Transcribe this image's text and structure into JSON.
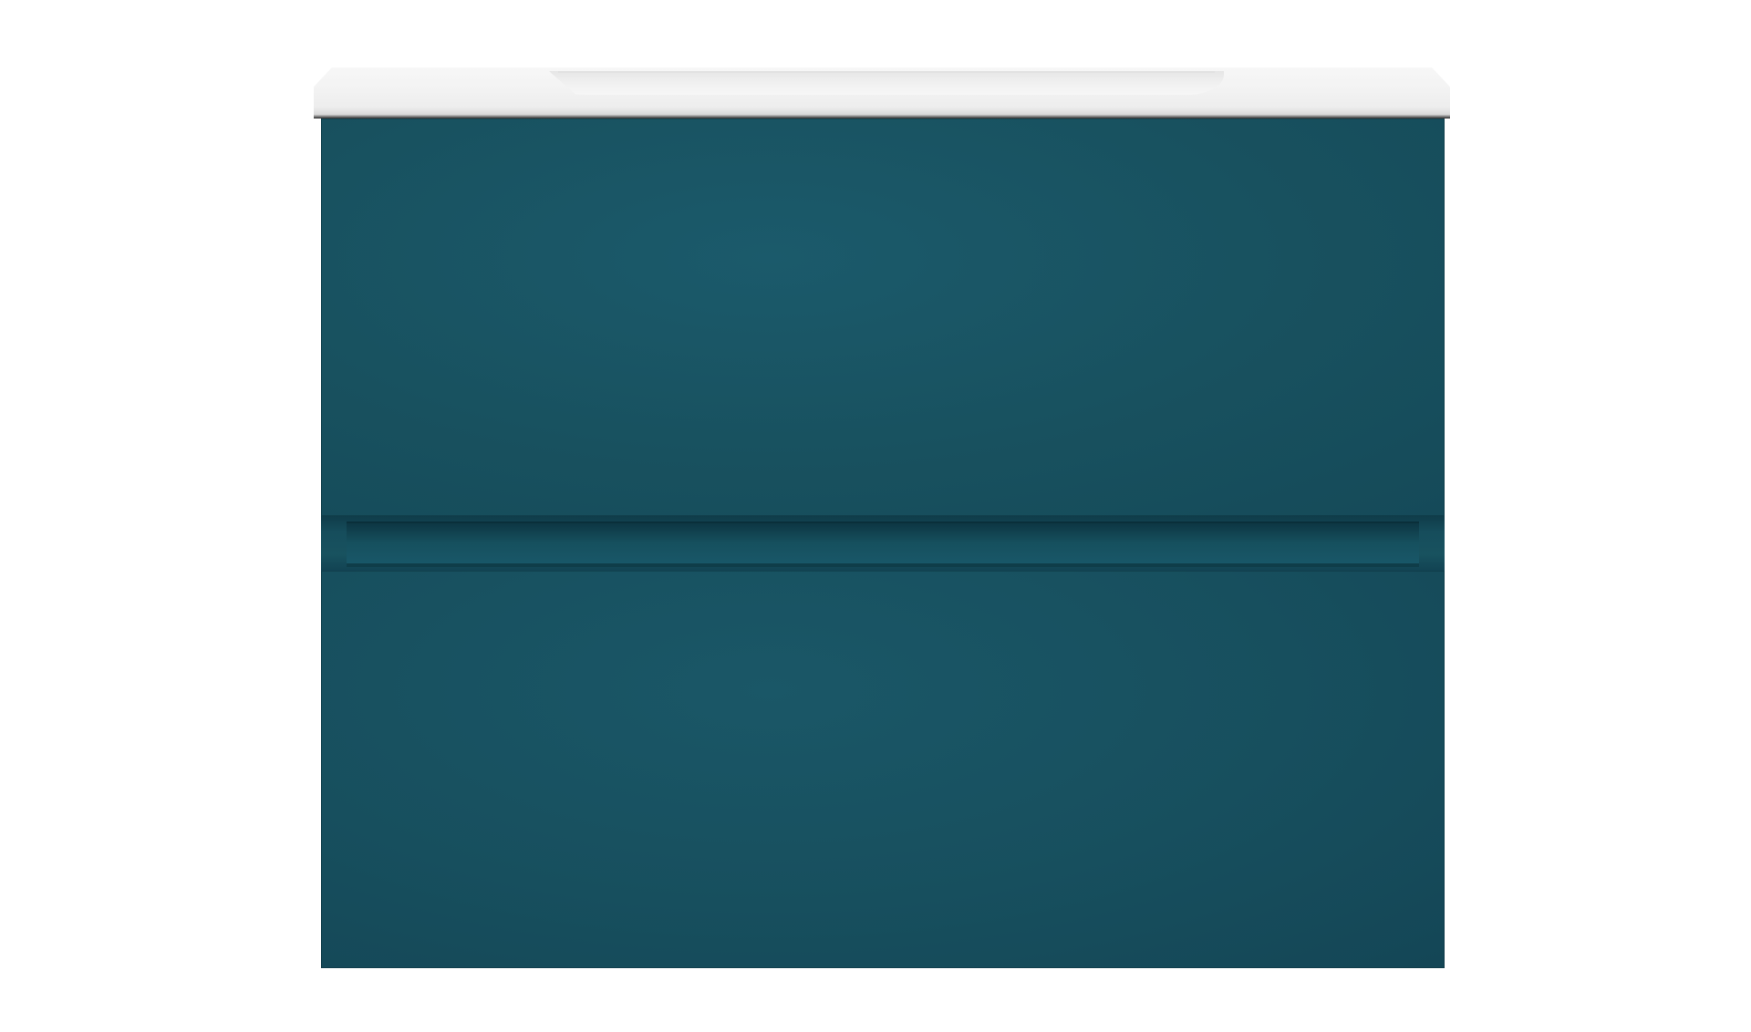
{
  "image": {
    "subject": "",
    "colors": {
      "background": "#ffffff",
      "cabinet": "#174b5a",
      "countertop": "#f3f3f3"
    }
  }
}
